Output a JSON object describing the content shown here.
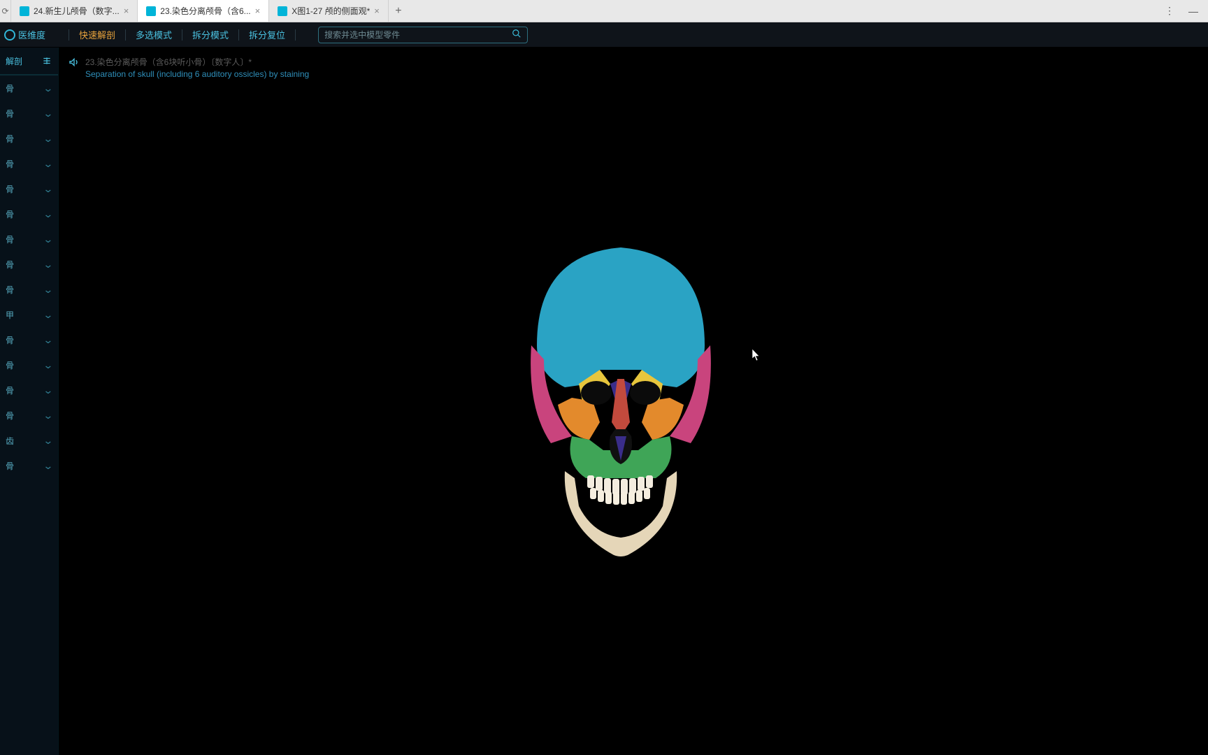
{
  "tabs": [
    {
      "title": "24.新生儿颅骨（数字...",
      "active": false
    },
    {
      "title": "23.染色分离颅骨（含6...",
      "active": true
    },
    {
      "title": "X图1-27 颅的侧面观*",
      "active": false
    }
  ],
  "brand": "医维度",
  "menu": {
    "fast": "快速解剖",
    "multi": "多选模式",
    "split": "拆分模式",
    "reset": "拆分复位"
  },
  "search_placeholder": "搜索并选中模型零件",
  "rail_top": "解剖",
  "rail_items": [
    {
      "label": "骨"
    },
    {
      "label": "骨"
    },
    {
      "label": "骨"
    },
    {
      "label": "骨"
    },
    {
      "label": "骨"
    },
    {
      "label": "骨"
    },
    {
      "label": "骨"
    },
    {
      "label": "骨"
    },
    {
      "label": "骨"
    },
    {
      "label": "甲"
    },
    {
      "label": "骨"
    },
    {
      "label": "骨"
    },
    {
      "label": "骨"
    },
    {
      "label": "骨"
    },
    {
      "label": "齿"
    },
    {
      "label": "骨"
    }
  ],
  "breadcrumb": {
    "cn": "23.染色分离颅骨（含6块听小骨）〔数字人〕*",
    "en": "Separation of skull (including 6 auditory ossicles) by staining"
  }
}
